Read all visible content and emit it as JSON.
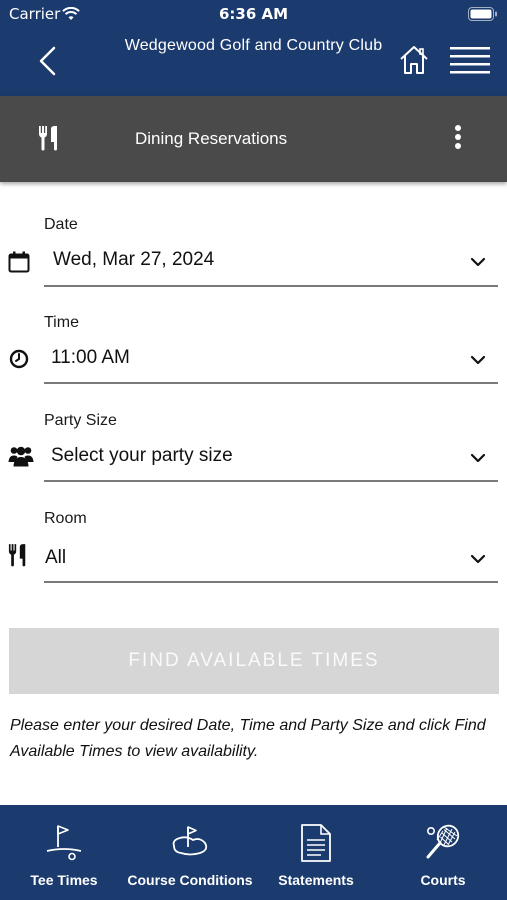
{
  "status_bar": {
    "carrier": "Carrier",
    "time": "6:36 AM"
  },
  "header": {
    "title": "Wedgewood Golf and Country Club",
    "accent_color": "#1b3a6e"
  },
  "subheader": {
    "title": "Dining Reservations",
    "icon": "utensils-icon"
  },
  "form": {
    "date": {
      "label": "Date",
      "value": "Wed, Mar 27, 2024",
      "icon": "calendar-icon"
    },
    "time": {
      "label": "Time",
      "value": "11:00 AM",
      "icon": "clock-icon"
    },
    "party_size": {
      "label": "Party Size",
      "value": "Select your party size",
      "icon": "users-icon"
    },
    "room": {
      "label": "Room",
      "value": "All",
      "icon": "utensils-icon"
    }
  },
  "find_button": {
    "label": "FIND AVAILABLE TIMES",
    "state": "disabled"
  },
  "help_text": "Please enter your desired Date, Time and Party Size and click Find Available Times to view availability.",
  "tabbar": {
    "tabs": [
      {
        "label": "Tee Times",
        "icon": "golf-flag-icon"
      },
      {
        "label": "Course Conditions",
        "icon": "golf-course-icon"
      },
      {
        "label": "Statements",
        "icon": "document-icon"
      },
      {
        "label": "Courts",
        "icon": "tennis-racket-icon"
      }
    ]
  }
}
